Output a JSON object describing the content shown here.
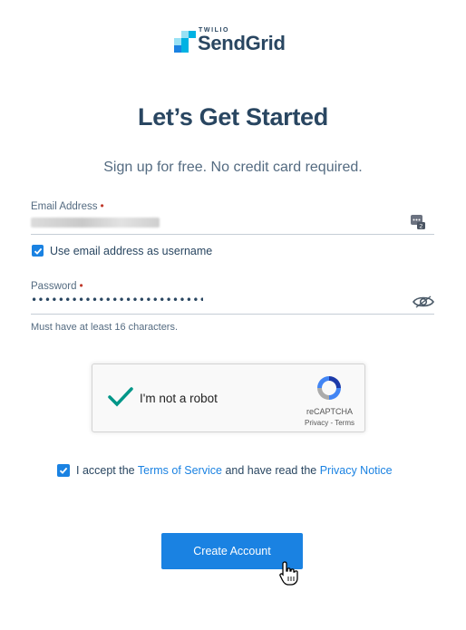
{
  "logo": {
    "small_text": "TWILIO",
    "name": "SendGrid",
    "colors": [
      "#00b2e3",
      "#1a82e2",
      "#99e1f4",
      "#294661"
    ]
  },
  "title": "Let’s Get Started",
  "subtitle": "Sign up for free. No credit card required.",
  "email": {
    "label": "Email Address",
    "required_marker": "•",
    "value": "",
    "icon": "password-manager-icon"
  },
  "use_email_as_username": {
    "label": "Use email address as username",
    "checked": true
  },
  "password": {
    "label": "Password",
    "required_marker": "•",
    "masked_value": "••••••••••••••••••••••••••••••••",
    "icon": "eye-icon",
    "hint": "Must have at least 16 characters."
  },
  "recaptcha": {
    "label": "I'm not a robot",
    "brand": "reCAPTCHA",
    "privacy": "Privacy",
    "separator": "-",
    "terms": "Terms",
    "verified": true
  },
  "accept": {
    "checked": true,
    "prefix": "I accept the",
    "terms_link": "Terms of Service",
    "middle": "and have read the",
    "privacy_link": "Privacy Notice"
  },
  "submit": {
    "label": "Create Account"
  },
  "colors": {
    "primary": "#1a82e2",
    "text": "#294661",
    "muted": "#546b81",
    "required": "#c0392b",
    "recaptcha_check": "#009688"
  }
}
